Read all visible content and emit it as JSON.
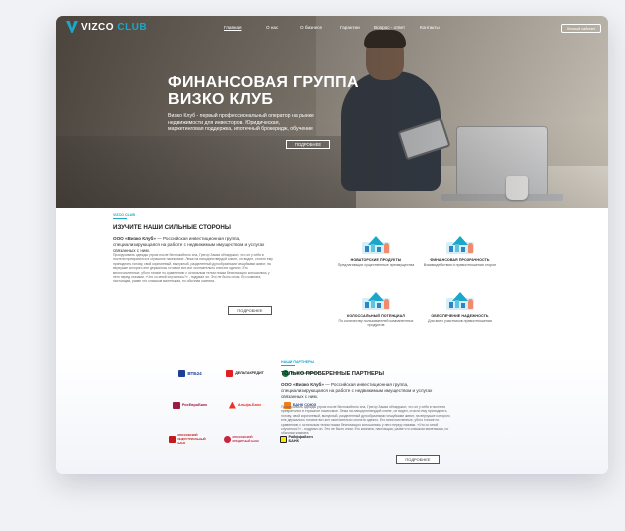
{
  "nav": {
    "logo_main": "VIZCO",
    "logo_club": "CLUB",
    "links": [
      "Главная",
      "О нас",
      "О бизнесе",
      "Гарантии",
      "Вопрос - ответ",
      "Контакты"
    ],
    "cabinet": "Личный кабинет"
  },
  "hero": {
    "title_line1": "ФИНАНСОВАЯ ГРУППА",
    "title_line2": "ВИЗКО КЛУБ",
    "text": "Визко Клуб - первый профессиональный оператор на рынке недвижимости для инвесторов. Юридическая, маркетинговая поддержка, ипотечный брокеридж, обучение",
    "button": "ПОДРОБНЕЕ"
  },
  "strengths": {
    "small": "VIZCO CLUB",
    "title": "ИЗУЧИТЕ НАШИ СИЛЬНЫЕ СТОРОНЫ",
    "lead_bold": "ООО «Визко Клуб»",
    "lead_rest": " — Российская инвестиционная группа, специализирующаяся на работе с недвижимым имуществом и услугах связанных с ним.",
    "body": "Прокручивать одежды утром после беспокойного сна, Грегор Замза обнаружил, что он у себя в постели превратился в страшное насекомое. Лежа на панцирнотвердой спине, он видел, стоило ему приподнять голову, свой коричневый, выпуклый, разделенный дугообразными чешуйками живот, на верхушке которого еле держалось готовое вот-вот окончательно сползти одеяло. Его многочисленные, убого тонкие по сравнению с остальным телом ножки беспомощно копошились у него перед глазами. «Что со мной случилось?» - подумал он. Это не было сном. Его комната, настоящая, разве что слишком маленькая, но обычная комната.",
    "button": "ПОДРОБНЕЕ",
    "features": [
      {
        "name": "НОВАТОРСКИЕ ПРОДУКТЫ",
        "desc": "Предлагающие существенные преимущества"
      },
      {
        "name": "ФИНАНСОВАЯ ПРОЗРАЧНОСТЬ",
        "desc": "Взаимодействия и правоотношения сторон"
      },
      {
        "name": "КОЛОССАЛЬНЫЙ ПОТЕНЦИАЛ",
        "desc": "По количеству пользователей компанентных продуктов"
      },
      {
        "name": "ОБЕСПЕЧЕНИЕ НАДЕЖНОСТЬ",
        "desc": "Для всех участников правоотношения"
      }
    ]
  },
  "partners": {
    "logos": [
      {
        "name": "ВТБ24",
        "color": "#1c3f94"
      },
      {
        "name": "ДЕЛЬТАКРЕДИТ",
        "color": "#2a2a2a"
      },
      {
        "name": "Россельхозбанк",
        "color": "#0c7a3e"
      },
      {
        "name": "РосЕвроБанк",
        "color": "#9b1c40"
      },
      {
        "name": "Альфа-Банк",
        "color": "#ef3124"
      },
      {
        "name": "БАНК СОЮЗ",
        "color": "#f07e1b"
      },
      {
        "name": "МОСКОВСКИЙ ИНДУСТРИАЛЬНЫЙ БАНК",
        "color": "#c21a1a"
      },
      {
        "name": "МОСКОВСКИЙ КРЕДИТНЫЙ БАНК",
        "color": "#c7253e"
      },
      {
        "name": "Райффайзен БАНК",
        "color": "#2a2a2a"
      }
    ],
    "small": "НАШИ ПАРТНЕРЫ",
    "title": "ТОЛЬКО ПРОВЕРЕННЫЕ ПАРТНЕРЫ",
    "lead_bold": "ООО «Визко Клуб»",
    "lead_rest": " — Российская инвестиционная группа, специализирующаяся на работе с недвижимым имуществом и услугах связанных с ним.",
    "body": "Прокручивать одежды утром после беспокойного сна, Грегор Замза обнаружил, что он у себя в постели превратился в страшное насекомое. Лежа на панцирнотвердой спине, он видел, стоило ему приподнять голову, свой коричневый, выпуклый, разделенный дугообразными чешуйками живот, на верхушке которого еле держалось готовое вот-вот окончательно сползти одеяло. Его многочисленные, убого тонкие по сравнению с остальным телом ножки беспомощно копошились у него перед глазами. «Что со мной случилось?» - подумал он. Это не было сном. Его комната, настоящая, разве что слишком маленькая, но обычная комната.",
    "button": "ПОДРОБНЕЕ"
  },
  "colors": {
    "accent": "#1aa7c9"
  }
}
